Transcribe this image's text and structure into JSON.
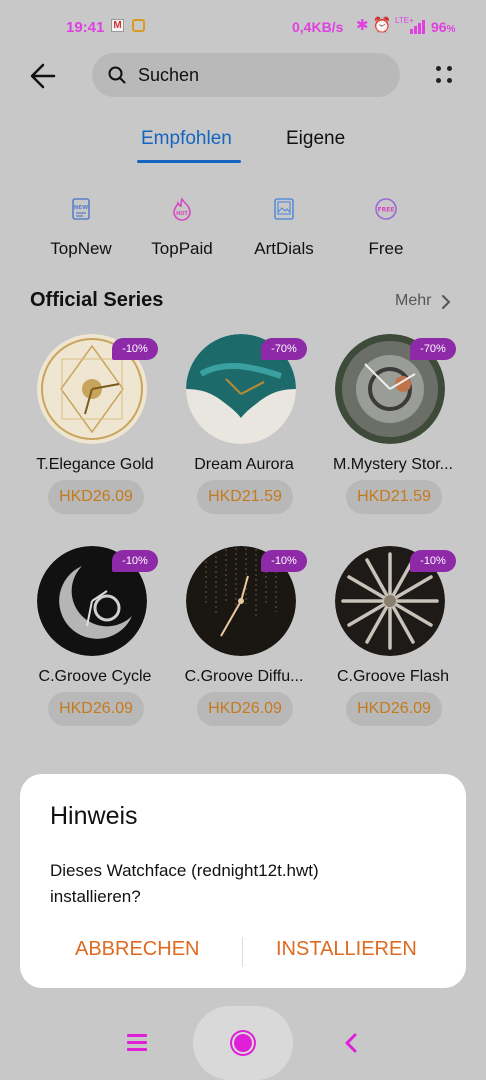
{
  "status_bar": {
    "time": "19:41",
    "mail_icon": "gmail-icon",
    "speed": "0,4KB/s",
    "network": "LTE+",
    "battery": "96",
    "battery_unit": "%",
    "accent": "#e040e0"
  },
  "header": {
    "search_placeholder": "Suchen",
    "back_icon": "arrow-left-icon",
    "more_icon": "more-dots-icon"
  },
  "tabs": [
    {
      "label": "Empfohlen",
      "active": true
    },
    {
      "label": "Eigene",
      "active": false
    }
  ],
  "categories": [
    {
      "label": "TopNew",
      "icon": "new-badge-icon",
      "icon_text": "NEW"
    },
    {
      "label": "TopPaid",
      "icon": "hot-badge-icon",
      "icon_text": "HOT"
    },
    {
      "label": "ArtDials",
      "icon": "picture-frame-icon"
    },
    {
      "label": "Free",
      "icon": "free-badge-icon",
      "icon_text": "FREE"
    }
  ],
  "section": {
    "title": "Official Series",
    "more": "Mehr"
  },
  "watchfaces": [
    {
      "name": "T.Elegance Gold",
      "price": "HKD26.09",
      "discount": "-10%"
    },
    {
      "name": "Dream Aurora",
      "price": "HKD21.59",
      "discount": "-70%"
    },
    {
      "name": "M.Mystery Stor...",
      "price": "HKD21.59",
      "discount": "-70%"
    },
    {
      "name": "C.Groove Cycle",
      "price": "HKD26.09",
      "discount": "-10%"
    },
    {
      "name": "C.Groove Diffu...",
      "price": "HKD26.09",
      "discount": "-10%"
    },
    {
      "name": "C.Groove Flash",
      "price": "HKD26.09",
      "discount": "-10%"
    }
  ],
  "dialog": {
    "title": "Hinweis",
    "message": "Dieses Watchface (rednight12t.hwt) installieren?",
    "cancel": "ABBRECHEN",
    "install": "INSTALLIEREN",
    "button_color": "#e06a20"
  },
  "colors": {
    "accent_blue": "#1565c0",
    "price_orange": "#c47a1e",
    "badge_purple": "#8e2aa8",
    "nav_magenta": "#e020d8"
  }
}
